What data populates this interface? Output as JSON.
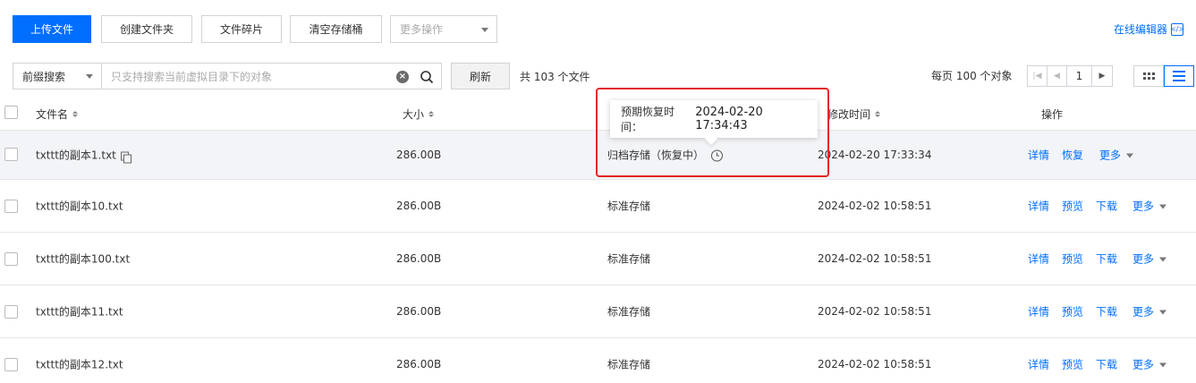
{
  "toolbar": {
    "upload_label": "上传文件",
    "create_folder_label": "创建文件夹",
    "fragments_label": "文件碎片",
    "clear_bucket_label": "清空存储桶",
    "more_ops_label": "更多操作",
    "online_editor_label": "在线编辑器",
    "online_editor_icon": "</>"
  },
  "search": {
    "prefix_label": "前缀搜索",
    "placeholder": "只支持搜索当前虚拟目录下的对象",
    "clear_icon": "×",
    "refresh_label": "刷新",
    "total_label": "共 103 个文件"
  },
  "pagination": {
    "per_page_label": "每页 100 个对象",
    "first_icon": "◀",
    "prev_icon": "◀",
    "current_page": "1",
    "next_icon": "▶"
  },
  "table": {
    "headers": {
      "name": "文件名",
      "size": "大小",
      "modified": "修改时间",
      "ops": "操作"
    },
    "rows": [
      {
        "name": "txttt的副本1.txt",
        "size": "286.00B",
        "storage": "归档存储（恢复中）",
        "modified": "2024-02-20 17:33:34",
        "op1": "详情",
        "op2": "恢复",
        "more": "更多"
      },
      {
        "name": "txttt的副本10.txt",
        "size": "286.00B",
        "storage": "标准存储",
        "modified": "2024-02-02 10:58:51",
        "op1": "详情",
        "op2": "预览",
        "op3": "下载",
        "more": "更多"
      },
      {
        "name": "txttt的副本100.txt",
        "size": "286.00B",
        "storage": "标准存储",
        "modified": "2024-02-02 10:58:51",
        "op1": "详情",
        "op2": "预览",
        "op3": "下载",
        "more": "更多"
      },
      {
        "name": "txttt的副本11.txt",
        "size": "286.00B",
        "storage": "标准存储",
        "modified": "2024-02-02 10:58:51",
        "op1": "详情",
        "op2": "预览",
        "op3": "下载",
        "more": "更多"
      },
      {
        "name": "txttt的副本12.txt",
        "size": "286.00B",
        "storage": "标准存储",
        "modified": "2024-02-02 10:58:51",
        "op1": "详情",
        "op2": "预览",
        "op3": "下载",
        "more": "更多"
      }
    ]
  },
  "tooltip": {
    "label": "预期恢复时间：",
    "value": "2024-02-20 17:34:43"
  },
  "colors": {
    "accent": "#006eff",
    "highlight_border": "#e42525"
  }
}
